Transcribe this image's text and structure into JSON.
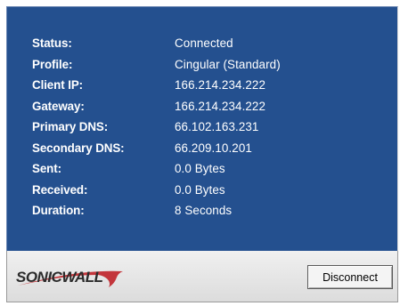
{
  "status_panel": {
    "rows": [
      {
        "label": "Status:",
        "value": "Connected"
      },
      {
        "label": "Profile:",
        "value": "Cingular (Standard)"
      },
      {
        "label": "Client IP:",
        "value": "166.214.234.222"
      },
      {
        "label": "Gateway:",
        "value": "166.214.234.222"
      },
      {
        "label": "Primary DNS:",
        "value": "66.102.163.231"
      },
      {
        "label": "Secondary DNS:",
        "value": "66.209.10.201"
      },
      {
        "label": "Sent:",
        "value": "0.0 Bytes"
      },
      {
        "label": "Received:",
        "value": "0.0 Bytes"
      },
      {
        "label": "Duration:",
        "value": "8 Seconds"
      }
    ]
  },
  "footer": {
    "logo_text": "SONICWALL",
    "logo_icon": "sonicwall-swoosh-logo",
    "disconnect_label": "Disconnect"
  },
  "colors": {
    "panel_background": "#24508f",
    "text": "#ffffff",
    "logo_swoosh": "#c0262c"
  }
}
